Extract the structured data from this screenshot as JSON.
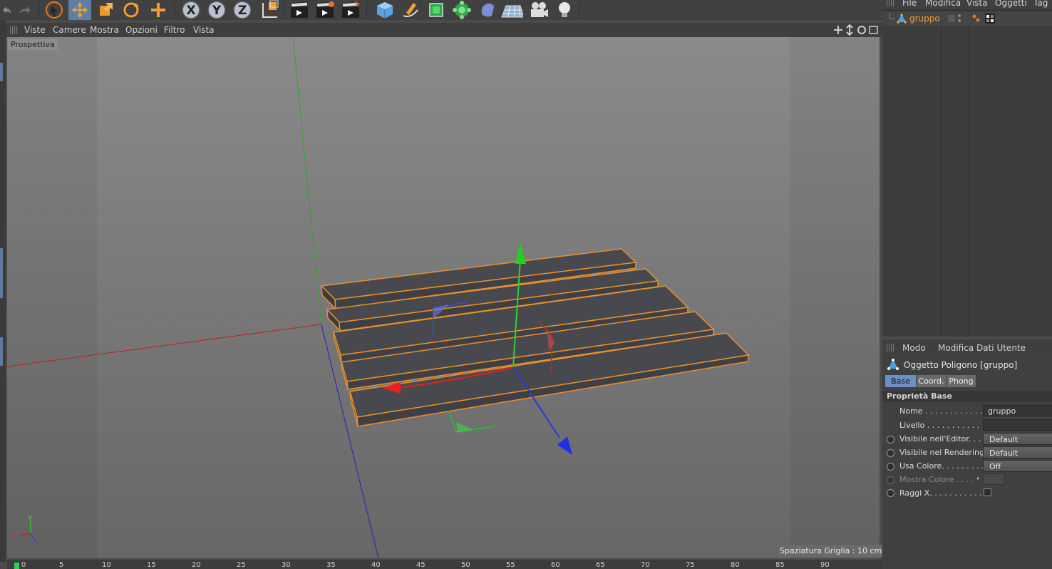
{
  "toolbar": {
    "axis_labels": [
      "X",
      "Y",
      "Z"
    ]
  },
  "viewport_menu": {
    "items": [
      "Viste",
      "Camere",
      "Mostra",
      "Opzioni",
      "Filtro",
      "Vista"
    ]
  },
  "viewport": {
    "view_label": "Prospettiva",
    "grid_spacing": "Spaziatura Griglia : 10 cm",
    "axis_glyph": {
      "x": "X",
      "y": "Y",
      "z": "Z"
    }
  },
  "timeline": {
    "ticks": [
      "0",
      "5",
      "10",
      "15",
      "20",
      "25",
      "30",
      "35",
      "40",
      "45",
      "50",
      "55",
      "60",
      "65",
      "70",
      "75",
      "80",
      "85",
      "90"
    ]
  },
  "object_manager": {
    "menu": [
      "File",
      "Modifica",
      "Vista",
      "Oggetti",
      "Tag"
    ],
    "objects": [
      {
        "name": "gruppo"
      }
    ]
  },
  "attribute_manager": {
    "menu": [
      "Modo",
      "Modifica",
      "Dati Utente"
    ],
    "object_title": "Oggetto Poligono [gruppo]",
    "tabs": [
      "Base",
      "Coord.",
      "Phong"
    ],
    "active_tab": "Base",
    "section": "Proprietà Base",
    "fields": {
      "nome_label": "Nome . . . . . . . . . . . . . . .",
      "nome_value": "gruppo",
      "livello_label": "Livello . . . . . . . . . . . . .",
      "vis_editor_label": "Visibile nell'Editor. . . .",
      "vis_editor_value": "Default",
      "vis_render_label": "Visibile nel Rendering",
      "vis_render_value": "Default",
      "usa_colore_label": "Usa Colore. . . . . . . . . .",
      "usa_colore_value": "Off",
      "mostra_colore_label": "Mostra Colore . . . .",
      "raggi_label": "Raggi X. . . . . . . . . . . . ."
    }
  },
  "colors": {
    "accent_selection": "#5f7ea6",
    "object_name": "#f0a02a",
    "outline": "#e8902c"
  }
}
